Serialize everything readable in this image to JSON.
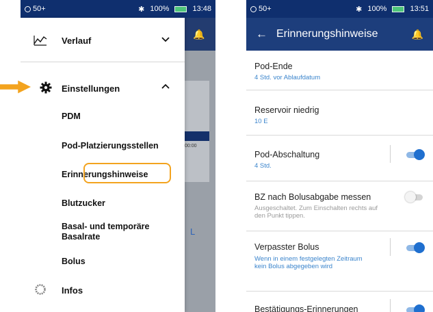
{
  "colors": {
    "brand_dark": "#0f2f6e",
    "header": "#1d3e7c",
    "accent_orange": "#f3a31e",
    "link_blue": "#3a84cc",
    "toggle_on": "#1f6fcf"
  },
  "phone1": {
    "status": {
      "pod_indicator": "50+",
      "battery": "100%",
      "time": "13:48"
    },
    "menu": {
      "verlauf": "Verlauf",
      "einstellungen": "Einstellungen",
      "sub_items": [
        "PDM",
        "Pod-Platzierungsstellen",
        "Erinnerungshinweise",
        "Blutzucker",
        "Basal- und temporäre Basalrate",
        "Bolus"
      ],
      "infos": "Infos"
    },
    "background": {
      "time_label": "00:00",
      "partial_letter": "L"
    }
  },
  "phone2": {
    "status": {
      "pod_indicator": "50+",
      "battery": "100%",
      "time": "13:51"
    },
    "header": {
      "title": "Erinnerungshinweise"
    },
    "rows": [
      {
        "title": "Pod-Ende",
        "subtitle": "4 Std. vor Ablaufdatum"
      },
      {
        "title": "Reservoir niedrig",
        "subtitle": "10 E"
      },
      {
        "title": "Pod-Abschaltung",
        "subtitle": "4 Std.",
        "toggle": "on"
      },
      {
        "title": "BZ nach Bolusabgabe messen",
        "subtitle": "Ausgeschaltet. Zum Einschalten rechts auf den Punkt tippen.",
        "toggle": "off"
      },
      {
        "title": "Verpasster Bolus",
        "subtitle": "Wenn in einem festgelegten Zeitraum kein Bolus abgegeben wird",
        "toggle": "on"
      },
      {
        "title": "Bestätigungs-Erinnerungen",
        "toggle": "on"
      }
    ]
  }
}
